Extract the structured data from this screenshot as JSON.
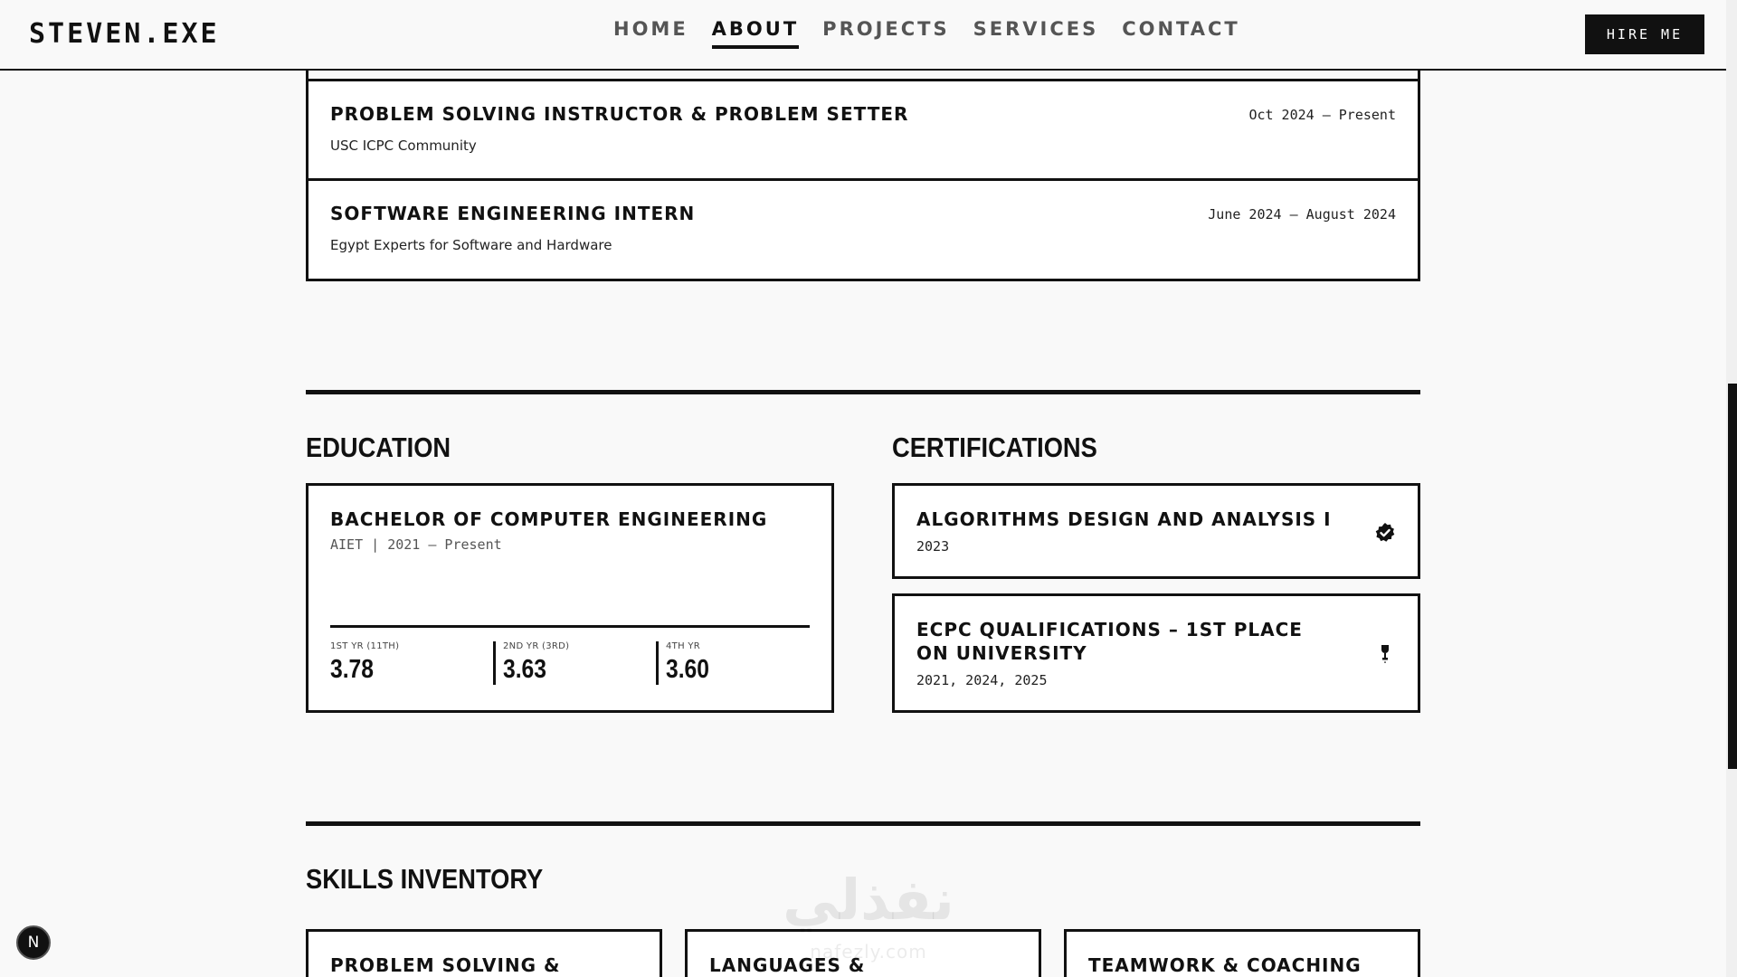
{
  "header": {
    "logo": "STEVEN.EXE",
    "nav": [
      "HOME",
      "ABOUT",
      "PROJECTS",
      "SERVICES",
      "CONTACT"
    ],
    "active_nav": "ABOUT",
    "hire_label": "HIRE ME"
  },
  "experience": [
    {
      "title": "PROBLEM SOLVING INSTRUCTOR & PROBLEM SETTER",
      "company": "USC ICPC Community",
      "date": "Oct 2024 – Present"
    },
    {
      "title": "SOFTWARE ENGINEERING INTERN",
      "company": "Egypt Experts for Software and Hardware",
      "date": "June 2024 – August 2024"
    }
  ],
  "education": {
    "heading": "EDUCATION",
    "degree": "BACHELOR OF COMPUTER ENGINEERING",
    "institution_line": "AIET | 2021 – Present",
    "gpa": [
      {
        "label": "1ST YR (11TH)",
        "value": "3.78"
      },
      {
        "label": "2ND YR (3RD)",
        "value": "3.63"
      },
      {
        "label": "4TH YR",
        "value": "3.60"
      }
    ]
  },
  "certifications": {
    "heading": "CERTIFICATIONS",
    "items": [
      {
        "title": "ALGORITHMS DESIGN AND ANALYSIS I",
        "years": "2023",
        "icon": "verified-badge-icon"
      },
      {
        "title": "ECPC QUALIFICATIONS – 1ST PLACE ON UNIVERSITY",
        "years": "2021, 2024, 2025",
        "icon": "trophy-icon"
      }
    ]
  },
  "skills": {
    "heading": "SKILLS INVENTORY",
    "cards": [
      "PROBLEM SOLVING &",
      "LANGUAGES & PROGRAMMING",
      "TEAMWORK & COACHING"
    ]
  },
  "watermark": {
    "main": "نفذلي",
    "sub": "nafezly.com"
  },
  "dev_badge": {
    "label": "N"
  },
  "colors": {
    "ink": "#111111",
    "background": "#f9f9f9",
    "card": "#ffffff"
  }
}
